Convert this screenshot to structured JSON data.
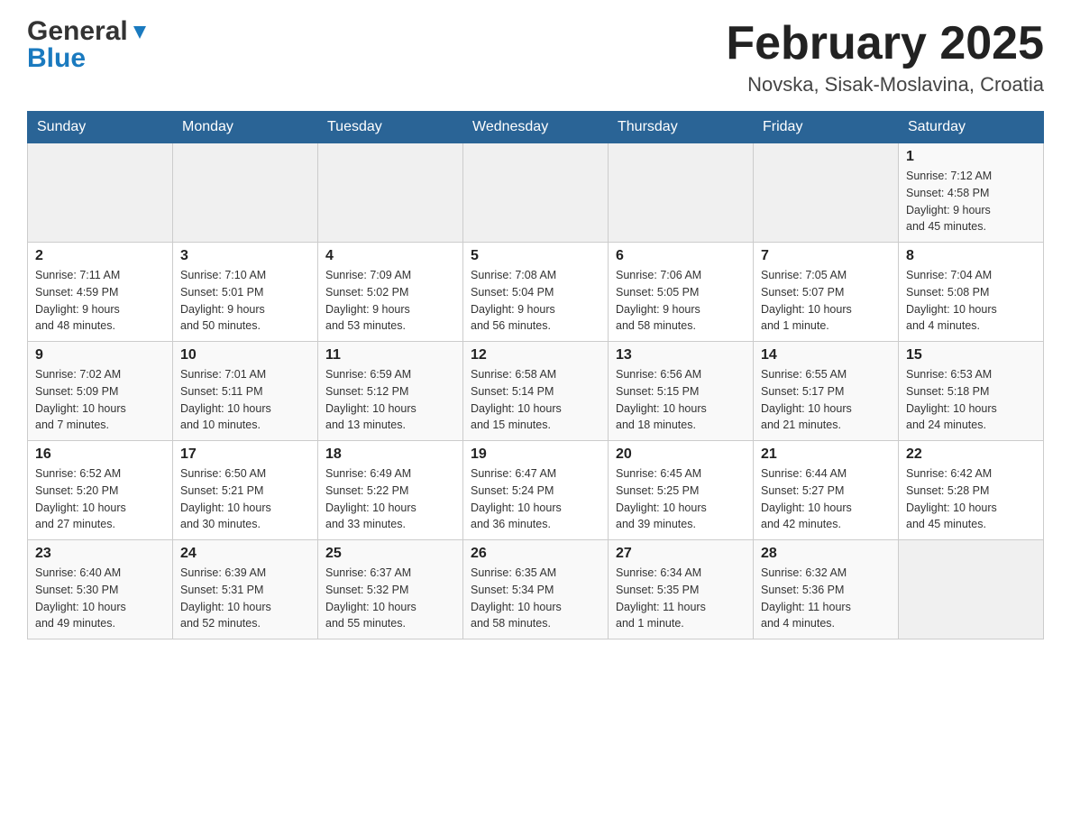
{
  "header": {
    "logo_line1": "General",
    "logo_line2": "Blue",
    "month_title": "February 2025",
    "location": "Novska, Sisak-Moslavina, Croatia"
  },
  "days_of_week": [
    "Sunday",
    "Monday",
    "Tuesday",
    "Wednesday",
    "Thursday",
    "Friday",
    "Saturday"
  ],
  "weeks": [
    [
      {
        "day": "",
        "info": ""
      },
      {
        "day": "",
        "info": ""
      },
      {
        "day": "",
        "info": ""
      },
      {
        "day": "",
        "info": ""
      },
      {
        "day": "",
        "info": ""
      },
      {
        "day": "",
        "info": ""
      },
      {
        "day": "1",
        "info": "Sunrise: 7:12 AM\nSunset: 4:58 PM\nDaylight: 9 hours\nand 45 minutes."
      }
    ],
    [
      {
        "day": "2",
        "info": "Sunrise: 7:11 AM\nSunset: 4:59 PM\nDaylight: 9 hours\nand 48 minutes."
      },
      {
        "day": "3",
        "info": "Sunrise: 7:10 AM\nSunset: 5:01 PM\nDaylight: 9 hours\nand 50 minutes."
      },
      {
        "day": "4",
        "info": "Sunrise: 7:09 AM\nSunset: 5:02 PM\nDaylight: 9 hours\nand 53 minutes."
      },
      {
        "day": "5",
        "info": "Sunrise: 7:08 AM\nSunset: 5:04 PM\nDaylight: 9 hours\nand 56 minutes."
      },
      {
        "day": "6",
        "info": "Sunrise: 7:06 AM\nSunset: 5:05 PM\nDaylight: 9 hours\nand 58 minutes."
      },
      {
        "day": "7",
        "info": "Sunrise: 7:05 AM\nSunset: 5:07 PM\nDaylight: 10 hours\nand 1 minute."
      },
      {
        "day": "8",
        "info": "Sunrise: 7:04 AM\nSunset: 5:08 PM\nDaylight: 10 hours\nand 4 minutes."
      }
    ],
    [
      {
        "day": "9",
        "info": "Sunrise: 7:02 AM\nSunset: 5:09 PM\nDaylight: 10 hours\nand 7 minutes."
      },
      {
        "day": "10",
        "info": "Sunrise: 7:01 AM\nSunset: 5:11 PM\nDaylight: 10 hours\nand 10 minutes."
      },
      {
        "day": "11",
        "info": "Sunrise: 6:59 AM\nSunset: 5:12 PM\nDaylight: 10 hours\nand 13 minutes."
      },
      {
        "day": "12",
        "info": "Sunrise: 6:58 AM\nSunset: 5:14 PM\nDaylight: 10 hours\nand 15 minutes."
      },
      {
        "day": "13",
        "info": "Sunrise: 6:56 AM\nSunset: 5:15 PM\nDaylight: 10 hours\nand 18 minutes."
      },
      {
        "day": "14",
        "info": "Sunrise: 6:55 AM\nSunset: 5:17 PM\nDaylight: 10 hours\nand 21 minutes."
      },
      {
        "day": "15",
        "info": "Sunrise: 6:53 AM\nSunset: 5:18 PM\nDaylight: 10 hours\nand 24 minutes."
      }
    ],
    [
      {
        "day": "16",
        "info": "Sunrise: 6:52 AM\nSunset: 5:20 PM\nDaylight: 10 hours\nand 27 minutes."
      },
      {
        "day": "17",
        "info": "Sunrise: 6:50 AM\nSunset: 5:21 PM\nDaylight: 10 hours\nand 30 minutes."
      },
      {
        "day": "18",
        "info": "Sunrise: 6:49 AM\nSunset: 5:22 PM\nDaylight: 10 hours\nand 33 minutes."
      },
      {
        "day": "19",
        "info": "Sunrise: 6:47 AM\nSunset: 5:24 PM\nDaylight: 10 hours\nand 36 minutes."
      },
      {
        "day": "20",
        "info": "Sunrise: 6:45 AM\nSunset: 5:25 PM\nDaylight: 10 hours\nand 39 minutes."
      },
      {
        "day": "21",
        "info": "Sunrise: 6:44 AM\nSunset: 5:27 PM\nDaylight: 10 hours\nand 42 minutes."
      },
      {
        "day": "22",
        "info": "Sunrise: 6:42 AM\nSunset: 5:28 PM\nDaylight: 10 hours\nand 45 minutes."
      }
    ],
    [
      {
        "day": "23",
        "info": "Sunrise: 6:40 AM\nSunset: 5:30 PM\nDaylight: 10 hours\nand 49 minutes."
      },
      {
        "day": "24",
        "info": "Sunrise: 6:39 AM\nSunset: 5:31 PM\nDaylight: 10 hours\nand 52 minutes."
      },
      {
        "day": "25",
        "info": "Sunrise: 6:37 AM\nSunset: 5:32 PM\nDaylight: 10 hours\nand 55 minutes."
      },
      {
        "day": "26",
        "info": "Sunrise: 6:35 AM\nSunset: 5:34 PM\nDaylight: 10 hours\nand 58 minutes."
      },
      {
        "day": "27",
        "info": "Sunrise: 6:34 AM\nSunset: 5:35 PM\nDaylight: 11 hours\nand 1 minute."
      },
      {
        "day": "28",
        "info": "Sunrise: 6:32 AM\nSunset: 5:36 PM\nDaylight: 11 hours\nand 4 minutes."
      },
      {
        "day": "",
        "info": ""
      }
    ]
  ]
}
